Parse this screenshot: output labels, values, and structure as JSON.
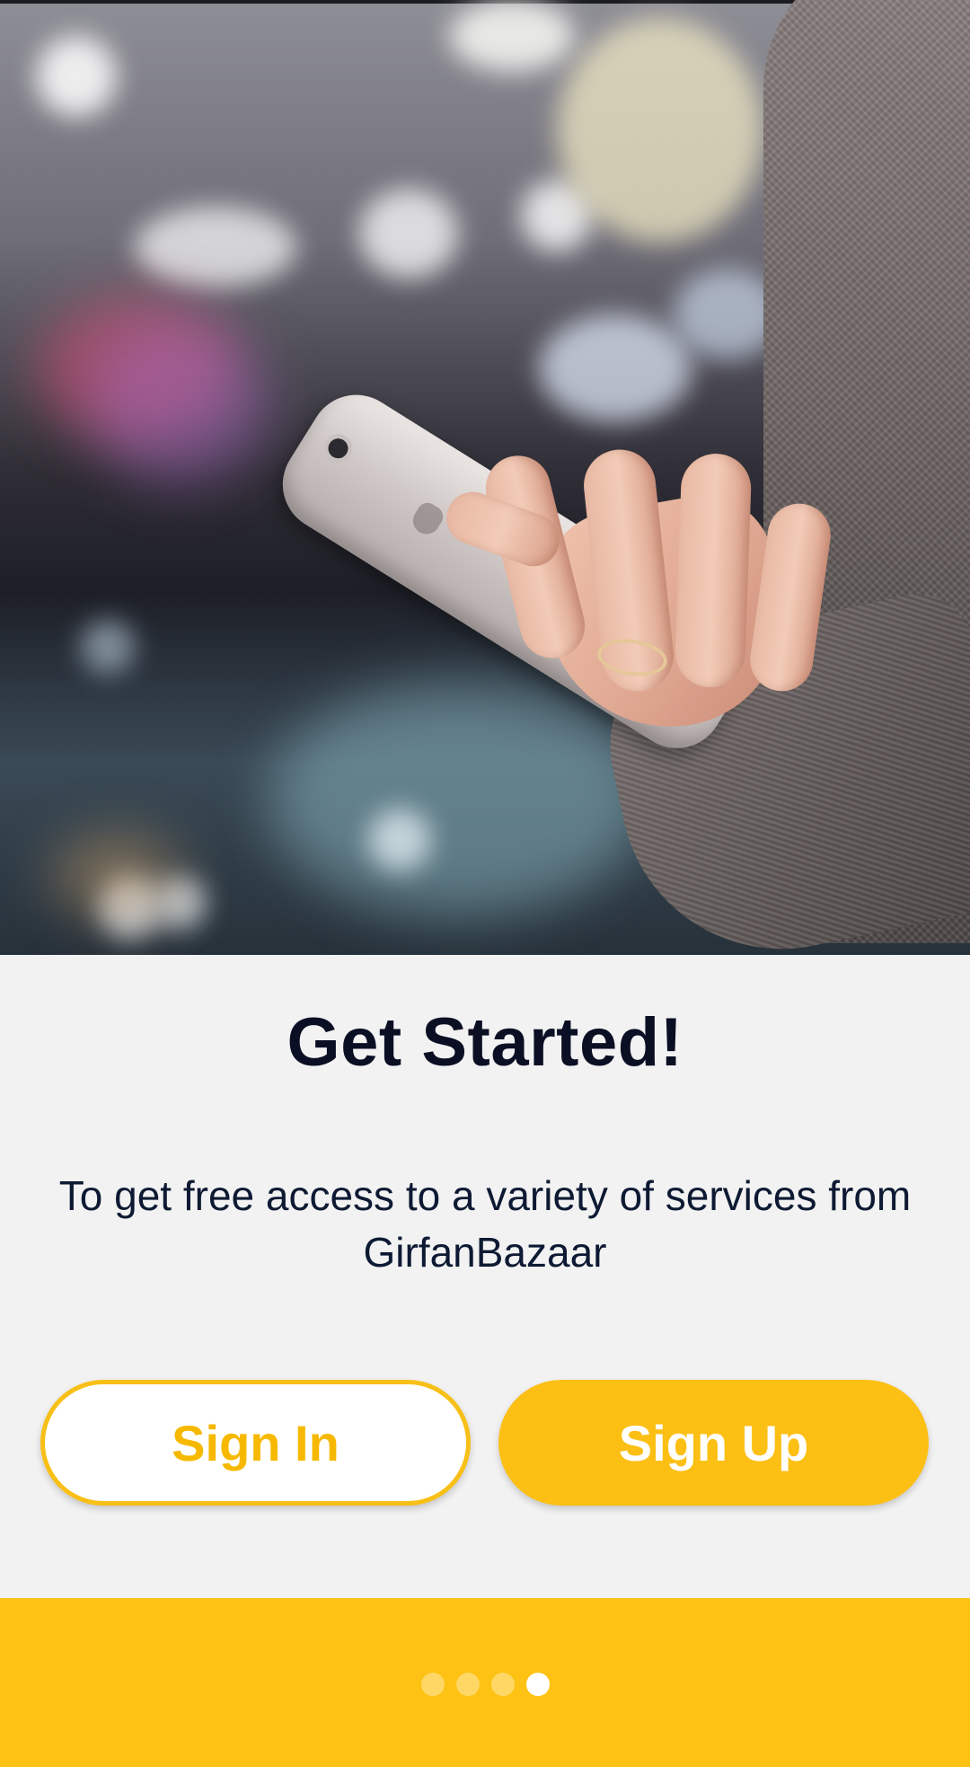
{
  "hero": {
    "description_icon": "hero-photo"
  },
  "onboarding": {
    "title": "Get Started!",
    "subtitle": "To get free access to a variety of services from GirfanBazaar"
  },
  "buttons": {
    "sign_in": "Sign In",
    "sign_up": "Sign Up"
  },
  "pager": {
    "total_pages": 4,
    "current_page": 4
  },
  "colors": {
    "accent": "#fcbf14",
    "background": "#f2f2f2",
    "title_text": "#0b0f24"
  }
}
